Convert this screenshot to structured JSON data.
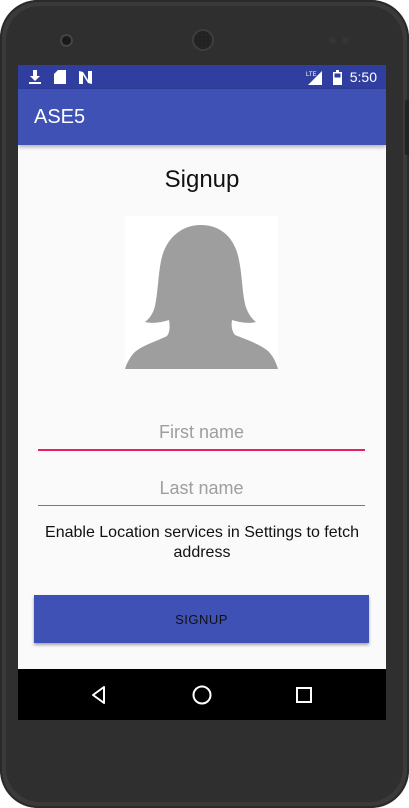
{
  "status_bar": {
    "time": "5:50",
    "left_icons": [
      "download-icon",
      "sd-card-icon",
      "n-notification-icon"
    ],
    "right_icons": [
      "lte-signal-icon",
      "battery-icon"
    ],
    "lte_label": "LTE"
  },
  "app_bar": {
    "title": "ASE5"
  },
  "signup": {
    "heading": "Signup",
    "avatar_icon": "female-profile-silhouette-icon",
    "first_name": {
      "placeholder": "First name",
      "value": ""
    },
    "last_name": {
      "placeholder": "Last name",
      "value": ""
    },
    "location_message": "Enable Location services in Settings to fetch address",
    "button_label": "SIGNUP"
  },
  "nav_bar": {
    "icons": [
      "back-icon",
      "home-icon",
      "recents-icon"
    ]
  },
  "colors": {
    "status_bar": "#303f9f",
    "primary": "#3f51b5",
    "accent": "#e91e63",
    "background": "#fafafa",
    "device_frame": "#3a3a3a"
  }
}
